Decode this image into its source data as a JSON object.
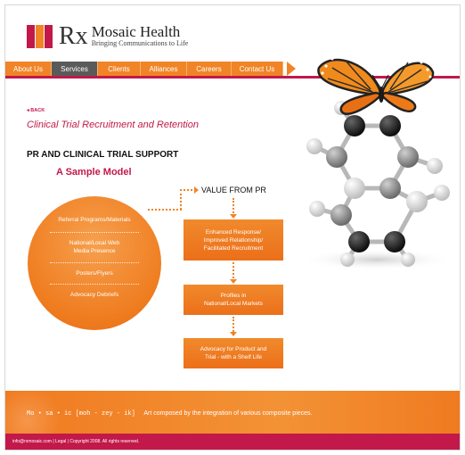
{
  "brand": {
    "rx": "Rx",
    "title": "Mosaic Health",
    "tagline": "Bringing Communications to Life",
    "colors": {
      "accent": "#c2184a",
      "orange": "#f08426",
      "active_nav": "#5a5a5a"
    }
  },
  "nav": {
    "items": [
      {
        "label": "About Us",
        "active": false
      },
      {
        "label": "Services",
        "active": true
      },
      {
        "label": "Clients",
        "active": false
      },
      {
        "label": "Alliances",
        "active": false
      },
      {
        "label": "Careers",
        "active": false
      },
      {
        "label": "Contact Us",
        "active": false
      }
    ]
  },
  "main": {
    "back_label": "◂ BACK",
    "title": "Clinical Trial Recruitment and Retention",
    "section_heading": "PR AND CLINICAL TRIAL SUPPORT",
    "sub_heading": "A Sample Model",
    "circle_items": [
      "Referral Programs/Materials",
      "National/Local Web\nMedia Presence",
      "Posters/Flyers",
      "Advocacy Debriefs"
    ],
    "value_label": "VALUE FROM PR",
    "boxes": [
      "Enhanced Response/\nImproved Relationship/\nFacilitated Recruitment",
      "Profiles in\nNational/Local Markets",
      "Advocacy for Product and\nTrial - with a Shelf Life"
    ]
  },
  "footer": {
    "definition_word": "Mo • sa • ic  [moh - zey - ik]",
    "definition_text": "Art composed by the integration of various composite pieces.",
    "legal": "info@rxmosaic.com | Legal | Copyright 2008. All rights reserved."
  },
  "illustration": {
    "icon": "butterfly-on-molecule-image"
  }
}
